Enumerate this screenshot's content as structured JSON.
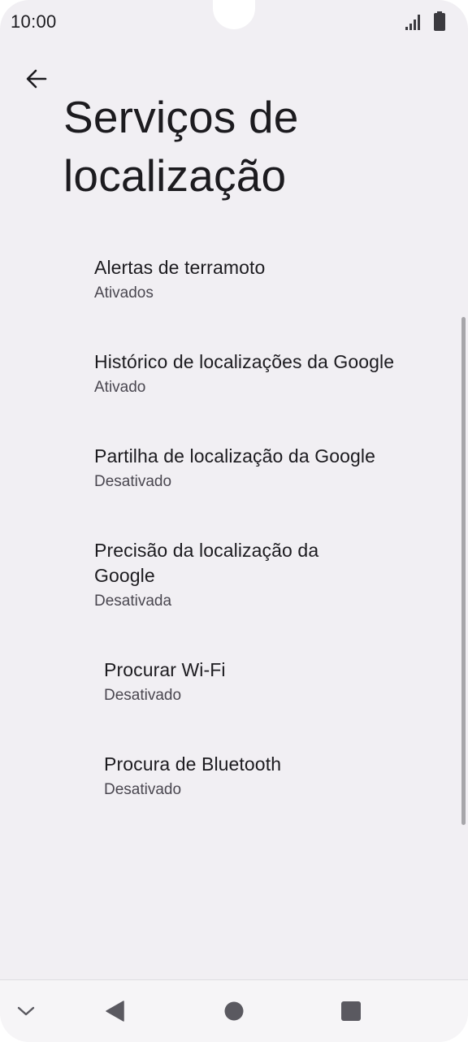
{
  "status_bar": {
    "time": "10:00"
  },
  "header": {
    "back_icon": "arrow-back-icon",
    "title": "Serviços de localização"
  },
  "items": [
    {
      "title": "Alertas de terramoto",
      "summary": "Ativados"
    },
    {
      "title": "Histórico de localizações da Google",
      "summary": "Ativado"
    },
    {
      "title": "Partilha de localização da Google",
      "summary": "Desativado"
    },
    {
      "title": "Precisão da localização da Google",
      "summary": "Desativada"
    },
    {
      "title": "Procurar Wi-Fi",
      "summary": "Desativado"
    },
    {
      "title": "Procura de Bluetooth",
      "summary": "Desativado"
    }
  ],
  "nav_bar": {
    "icons": [
      "chevron-down-icon",
      "back-triangle-icon",
      "home-circle-icon",
      "recents-square-icon"
    ]
  },
  "colors": {
    "background": "#f1eff3",
    "text_primary": "#1c1b1f",
    "text_secondary": "#4a4750"
  }
}
